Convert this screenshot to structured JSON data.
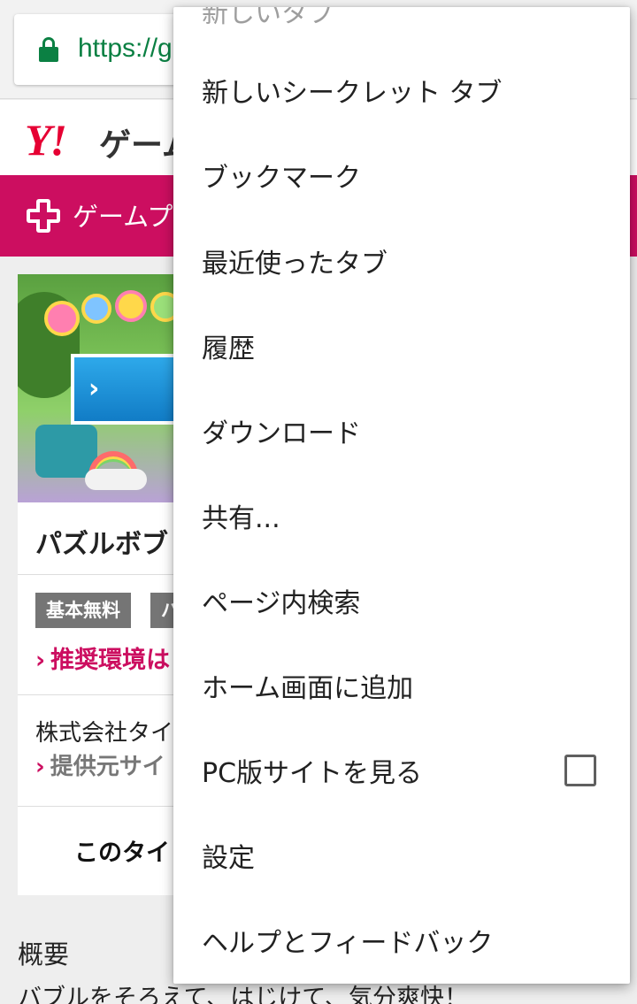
{
  "browser": {
    "url": "https://g"
  },
  "site": {
    "logo": "Y!",
    "logo_sub": "ゲーム",
    "nav_label": "ゲームプ"
  },
  "game": {
    "title": "パズルボブ",
    "tags": [
      "基本無料",
      "バ"
    ],
    "env_link": "推奨環境は",
    "company": "株式会社タイ",
    "provider_link": "提供元サイ",
    "cta": "このタイ"
  },
  "overview": {
    "heading": "概要",
    "text": "バブルをそろえて、はじけて、気分爽快！"
  },
  "menu": {
    "items": [
      {
        "label": "新しいタブ"
      },
      {
        "label": "新しいシークレット タブ"
      },
      {
        "label": "ブックマーク"
      },
      {
        "label": "最近使ったタブ"
      },
      {
        "label": "履歴"
      },
      {
        "label": "ダウンロード"
      },
      {
        "label": "共有..."
      },
      {
        "label": "ページ内検索"
      },
      {
        "label": "ホーム画面に追加"
      },
      {
        "label": "PC版サイトを見る",
        "checked": false
      },
      {
        "label": "設定"
      },
      {
        "label": "ヘルプとフィードバック"
      }
    ]
  },
  "icons": {
    "lock": "lock-icon",
    "nav": "plus-icon",
    "chevron": "chevron-right-icon"
  },
  "colors": {
    "secure_green": "#0b8043",
    "brand_pink": "#cc0e60",
    "yahoo_red": "#e60033"
  }
}
